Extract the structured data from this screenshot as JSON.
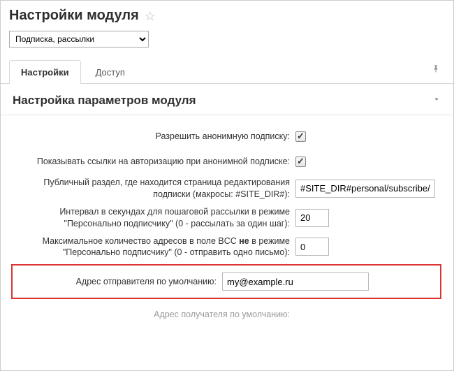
{
  "header": {
    "title": "Настройки модуля"
  },
  "module_select": {
    "selected": "Подписка, рассылки"
  },
  "tabs": {
    "items": [
      {
        "label": "Настройки",
        "active": true
      },
      {
        "label": "Доступ",
        "active": false
      }
    ]
  },
  "section": {
    "title": "Настройка параметров модуля"
  },
  "form": {
    "allow_anon_label": "Разрешить анонимную подписку:",
    "allow_anon_checked": true,
    "show_auth_links_label": "Показывать ссылки на авторизацию при анонимной подписке:",
    "show_auth_links_checked": true,
    "public_section_label": "Публичный раздел, где находится страница редактирования подписки (макросы: #SITE_DIR#):",
    "public_section_value": "#SITE_DIR#personal/subscribe/",
    "interval_label": "Интервал в секундах для пошаговой рассылки в режиме \"Персонально подписчику\" (0 - рассылать за один шаг):",
    "interval_value": "20",
    "bcc_max_label_pre": "Максимальное количество адресов в поле BCC ",
    "bcc_max_label_bold": "не",
    "bcc_max_label_post": " в режиме \"Персонально подписчику\" (0 - отправить одно письмо):",
    "bcc_max_value": "0",
    "sender_label": "Адрес отправителя по умолчанию:",
    "sender_value": "my@example.ru",
    "recipient_label": "Адрес получателя по умолчанию:"
  }
}
